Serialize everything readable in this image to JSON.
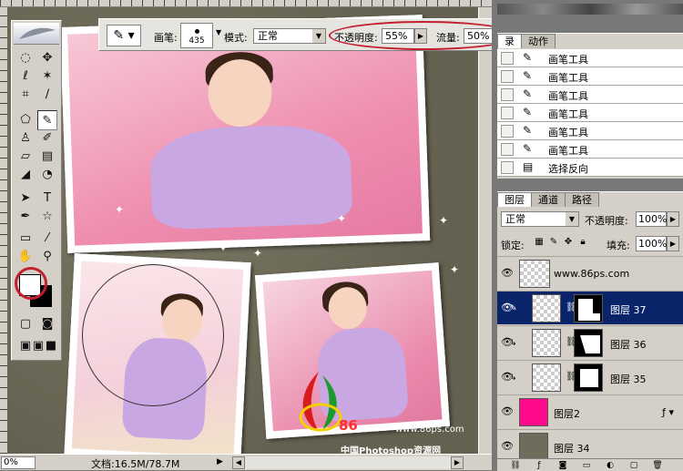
{
  "options_bar": {
    "brush_label": "画笔:",
    "brush_size": "435",
    "mode_label": "模式:",
    "mode_value": "正常",
    "opacity_label": "不透明度:",
    "opacity_value": "55%",
    "flow_label": "流量:",
    "flow_value": "50%"
  },
  "history": {
    "tabs": [
      "录",
      "动作"
    ],
    "rows": [
      {
        "icon": "brush-icon",
        "text": "画笔工具"
      },
      {
        "icon": "brush-icon",
        "text": "画笔工具"
      },
      {
        "icon": "brush-icon",
        "text": "画笔工具"
      },
      {
        "icon": "brush-icon",
        "text": "画笔工具"
      },
      {
        "icon": "brush-icon",
        "text": "画笔工具"
      },
      {
        "icon": "brush-icon",
        "text": "画笔工具"
      },
      {
        "icon": "selection-icon",
        "text": "选择反向"
      }
    ]
  },
  "layers": {
    "tabs": [
      "图层",
      "通道",
      "路径"
    ],
    "blend_mode": "正常",
    "opacity_label": "不透明度:",
    "opacity_value": "100%",
    "lock_label": "锁定:",
    "fill_label": "填充:",
    "fill_value": "100%",
    "rows": [
      {
        "name": "www.86ps.com",
        "selected": false
      },
      {
        "name": "图层 37",
        "selected": true
      },
      {
        "name": "图层 36",
        "selected": false
      },
      {
        "name": "图层 35",
        "selected": false
      },
      {
        "name": "图层2",
        "selected": false
      },
      {
        "name": "图层 34",
        "selected": false
      }
    ]
  },
  "status": {
    "zoom": "0%",
    "doc_size": "文档:16.5M/78.7M"
  },
  "watermark": {
    "logo": "86",
    "url": "www.86ps.com",
    "cn": "中国Photoshop资源网"
  },
  "colors": {
    "highlight_red": "#c21f2f",
    "selected_layer": "#0a246a",
    "pink_layer_thumb": "#ff0a8c"
  }
}
